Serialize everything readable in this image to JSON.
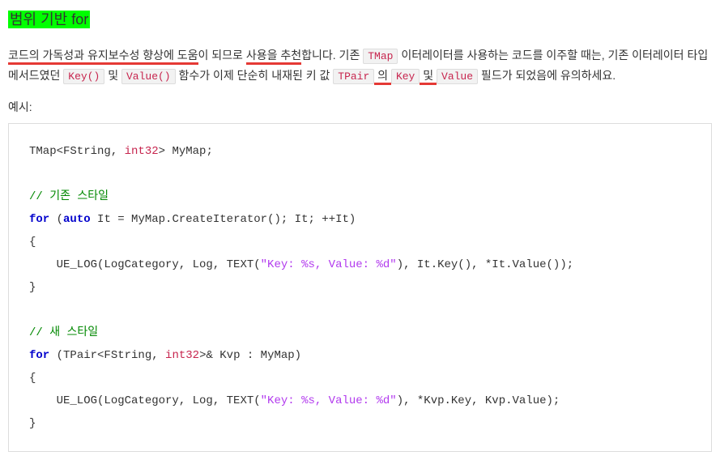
{
  "heading": "범위 기반 for",
  "paragraph": {
    "p1": "코드의 가독성과 유지보수성 향상에 도움",
    "p2": "이 되므로 ",
    "p3": "사용을 추천",
    "p4": "합니다. 기존 ",
    "tmap": "TMap",
    "p5": " 이터레이터를 사용하는 코드를 이주할 때는, 기존 이터레이터 타입 메서드였던 ",
    "key_fn": "Key()",
    "p6": " 및 ",
    "value_fn": "Value()",
    "p7": " 함수가 이제 단순히 내재된 키 값 ",
    "tpair": "TPair",
    "p8": " 의 ",
    "key": "Key",
    "p9": " 및 ",
    "value": "Value",
    "p10": " 필드가 되었음에 유의하세요."
  },
  "example_label": "예시:",
  "code": {
    "l1a": "TMap<FString, ",
    "l1b": "int32",
    "l1c": "> MyMap;",
    "blank": "",
    "c1": "// 기존 스타일",
    "l2a": "for",
    "l2b": " (",
    "l2c": "auto",
    "l2d": " It = MyMap.CreateIterator(); It; ++It)",
    "brace_open": "{",
    "l3a": "    UE_LOG(LogCategory, Log, TEXT(",
    "l3b": "\"Key: %s, Value: %d\"",
    "l3c": "), It.Key(), *It.Value());",
    "brace_close": "}",
    "c2": "// 새 스타일",
    "l4a": "for",
    "l4b": " (TPair<FString, ",
    "l4c": "int32",
    "l4d": ">& Kvp : MyMap)",
    "l5a": "    UE_LOG(LogCategory, Log, TEXT(",
    "l5b": "\"Key: %s, Value: %d\"",
    "l5c": "), *Kvp.Key, Kvp.Value);"
  }
}
